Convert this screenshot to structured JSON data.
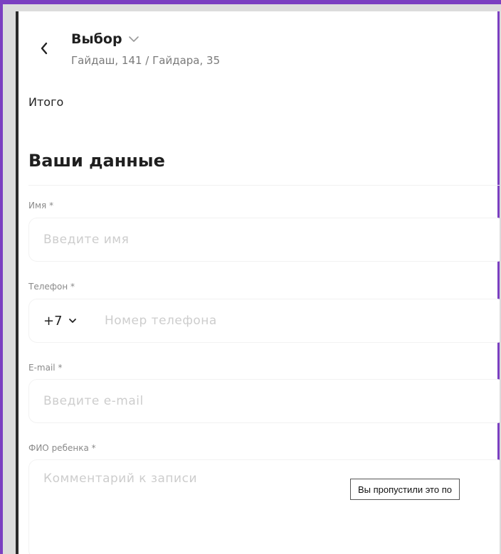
{
  "header": {
    "title": "Выбор",
    "subtitle": "Гайдаш, 141 / Гайдара, 35"
  },
  "summary": {
    "total_label": "Итого"
  },
  "form": {
    "section_title": "Ваши данные",
    "name": {
      "label": "Имя *",
      "placeholder": "Введите имя",
      "value": ""
    },
    "phone": {
      "label": "Телефон *",
      "country_code": "+7",
      "placeholder": "Номер телефона",
      "value": ""
    },
    "email": {
      "label": "E-mail *",
      "placeholder": "Введите e-mail",
      "value": ""
    },
    "child_name": {
      "label": "ФИО ребенка *",
      "placeholder": "Комментарий к записи",
      "value": ""
    }
  },
  "tooltip": {
    "text": "Вы пропустили это по"
  },
  "colors": {
    "frame_accent": "#7b3fc1",
    "placeholder": "#cdcdcd",
    "label": "#8a8a8a"
  }
}
